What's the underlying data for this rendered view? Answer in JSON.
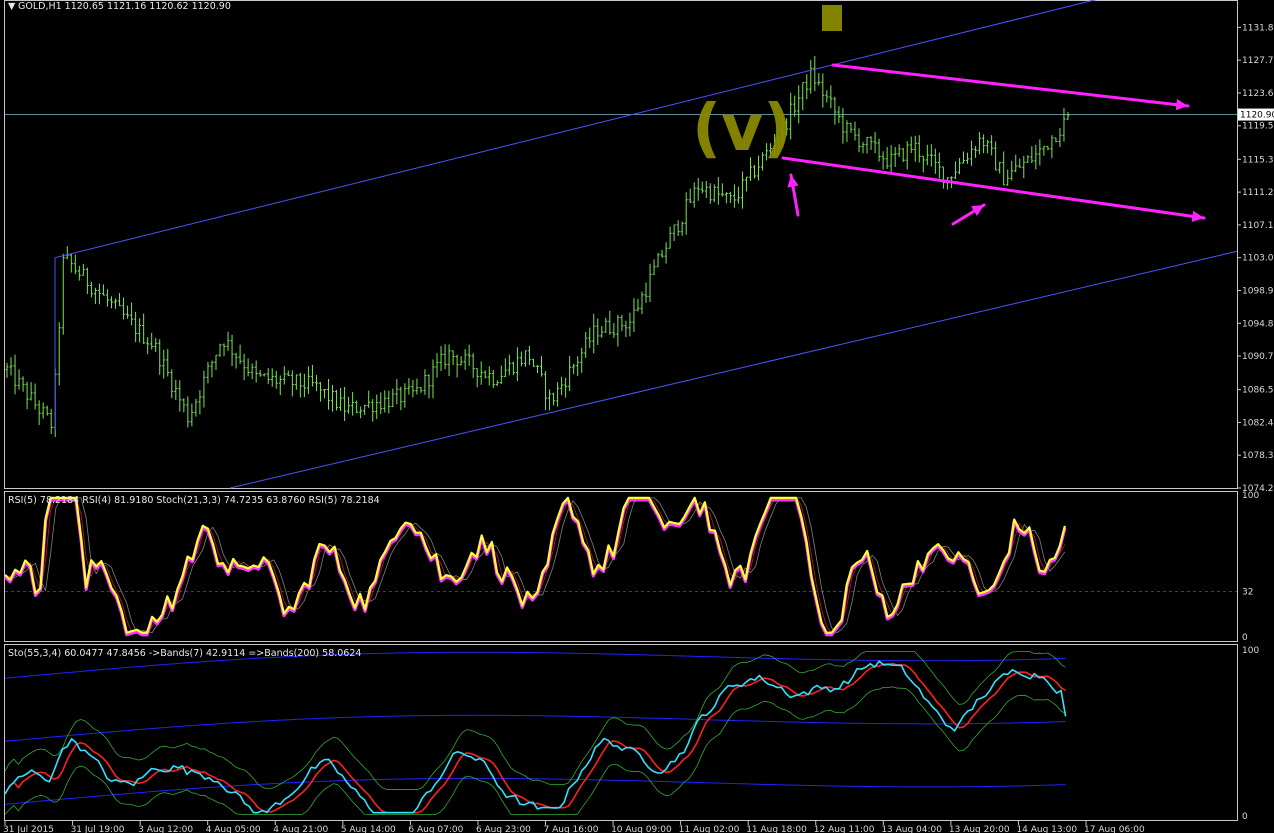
{
  "symbol_header": "GOLD,H1  1120.65 1121.16 1120.62 1120.90",
  "colors": {
    "background": "#000000",
    "frame": "#c8c8c8",
    "candle": "#79e35a",
    "channel": "#4a55ff",
    "annotation": "#ff22ff",
    "wave_label": "#8a8a00",
    "bid_line": "#6fa0b0",
    "rsi_main": "#ffff33",
    "rsi_glow": "#ff33ff",
    "stoch_main": "#33e0ff",
    "stoch_signal": "#ff2020",
    "bands_slow": "#2222ff",
    "bands_fast": "#33aa33"
  },
  "wave_label": "(v)",
  "panels": {
    "rsi": {
      "title": "RSI(5) 78.2184  RSI(4) 81.9180  Stoch(21,3,3) 74.7235 63.8760  RSI(5) 78.2184",
      "scale": [
        "100",
        "32",
        "0"
      ]
    },
    "stoch": {
      "title": "Sto(55,3,4) 60.0477 47.8456  ->Bands(7) 42.9114  =>Bands(200) 58.0624",
      "scale": [
        "100",
        "0"
      ]
    }
  },
  "chart_data": {
    "type": "candlestick",
    "symbol": "GOLD",
    "timeframe": "H1",
    "last_price": 1120.9,
    "last_price_label": "1120.90",
    "ylim": [
      1074.2,
      1135.1
    ],
    "y_ticks": [
      "1131.80",
      "1127.70",
      "1123.60",
      "1119.50",
      "1115.30",
      "1111.20",
      "1107.10",
      "1103.00",
      "1098.90",
      "1094.80",
      "1090.70",
      "1086.50",
      "1082.40",
      "1078.30",
      "1074.20"
    ],
    "x_ticks": [
      "31 Jul 2015",
      "31 Jul 19:00",
      "3 Aug 12:00",
      "4 Aug 05:00",
      "4 Aug 21:00",
      "5 Aug 14:00",
      "6 Aug 07:00",
      "6 Aug 23:00",
      "7 Aug 16:00",
      "10 Aug 09:00",
      "11 Aug 02:00",
      "11 Aug 18:00",
      "12 Aug 11:00",
      "13 Aug 04:00",
      "13 Aug 20:00",
      "14 Aug 13:00",
      "17 Aug 06:00"
    ],
    "price_path": [
      [
        0,
        1089
      ],
      [
        0.04,
        1082
      ],
      [
        0.05,
        1103
      ],
      [
        0.1,
        1096
      ],
      [
        0.13,
        1092
      ],
      [
        0.16,
        1083
      ],
      [
        0.19,
        1093
      ],
      [
        0.22,
        1088
      ],
      [
        0.27,
        1087
      ],
      [
        0.3,
        1084
      ],
      [
        0.36,
        1086
      ],
      [
        0.39,
        1091
      ],
      [
        0.43,
        1088
      ],
      [
        0.46,
        1091
      ],
      [
        0.48,
        1085
      ],
      [
        0.52,
        1094
      ],
      [
        0.55,
        1095
      ],
      [
        0.58,
        1104
      ],
      [
        0.61,
        1112
      ],
      [
        0.64,
        1110
      ],
      [
        0.68,
        1118
      ],
      [
        0.71,
        1126
      ],
      [
        0.74,
        1119
      ],
      [
        0.78,
        1115
      ],
      [
        0.8,
        1117
      ],
      [
        0.83,
        1113
      ],
      [
        0.86,
        1118
      ],
      [
        0.88,
        1113
      ],
      [
        0.91,
        1116
      ],
      [
        0.94,
        1121
      ]
    ],
    "channel": {
      "upper": [
        [
          "31 Jul 2015 ~19:00",
          1103.0
        ],
        [
          "17 Aug 06:00",
          1136.0
        ]
      ],
      "lower": [
        [
          "3 Aug",
          1074.2
        ],
        [
          "17 Aug 06:00",
          1103.5
        ]
      ]
    },
    "indicators": [
      {
        "name": "RSI(5)",
        "value": 78.2184
      },
      {
        "name": "RSI(4)",
        "value": 81.918
      },
      {
        "name": "Stoch(21,3,3)",
        "values": [
          74.7235,
          63.876
        ]
      },
      {
        "name": "Sto(55,3,4)",
        "values": [
          60.0477,
          47.8456
        ]
      },
      {
        "name": "->Bands(7)",
        "value": 42.9114
      },
      {
        "name": "=>Bands(200)",
        "value": 58.0624
      }
    ],
    "rsi_level": 32
  }
}
